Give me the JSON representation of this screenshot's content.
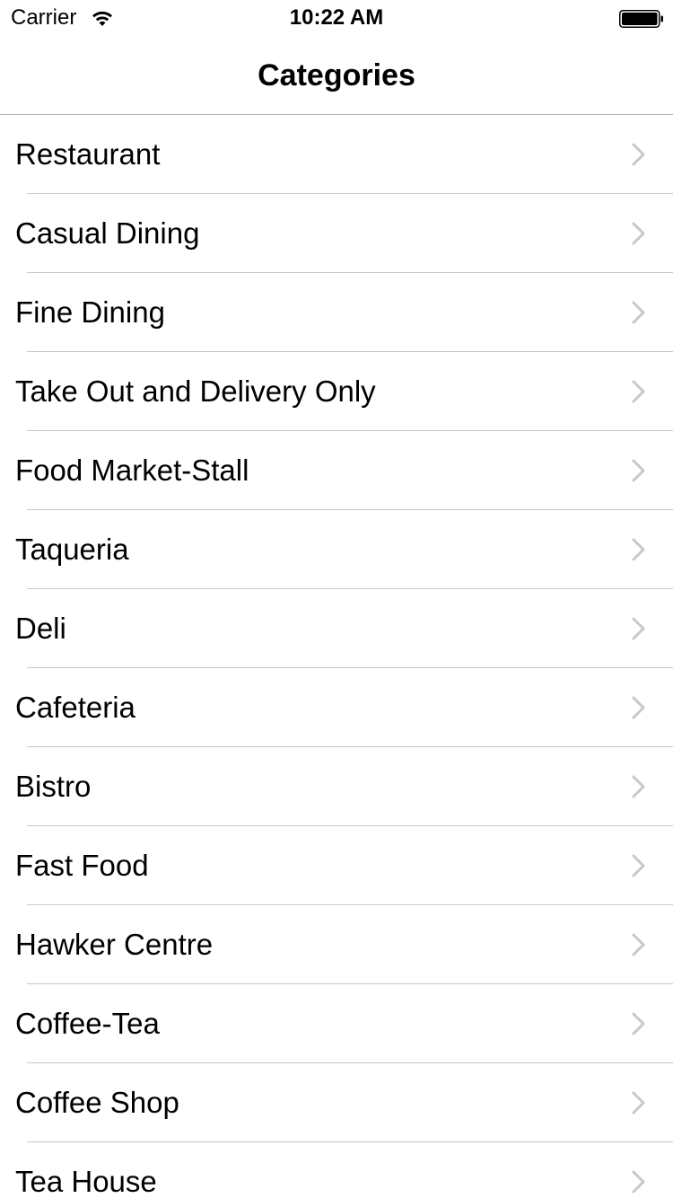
{
  "status_bar": {
    "carrier": "Carrier",
    "time": "10:22 AM"
  },
  "nav": {
    "title": "Categories"
  },
  "list": {
    "items": [
      {
        "label": "Restaurant"
      },
      {
        "label": "Casual Dining"
      },
      {
        "label": "Fine Dining"
      },
      {
        "label": "Take Out and Delivery Only"
      },
      {
        "label": "Food Market-Stall"
      },
      {
        "label": "Taqueria"
      },
      {
        "label": "Deli"
      },
      {
        "label": "Cafeteria"
      },
      {
        "label": "Bistro"
      },
      {
        "label": "Fast Food"
      },
      {
        "label": "Hawker Centre"
      },
      {
        "label": "Coffee-Tea"
      },
      {
        "label": "Coffee Shop"
      },
      {
        "label": "Tea House"
      }
    ]
  },
  "icons": {
    "wifi": "wifi-icon",
    "battery": "battery-icon",
    "chevron": "chevron-right-icon"
  },
  "colors": {
    "separator": "#c8c7cc",
    "chevron": "#c7c7cc",
    "text": "#000000",
    "background": "#ffffff"
  }
}
